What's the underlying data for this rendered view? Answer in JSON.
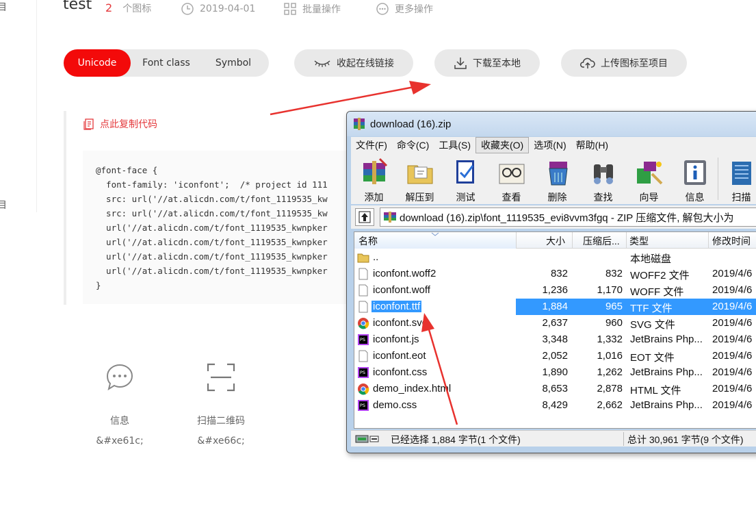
{
  "leftnav": {
    "item1": "目",
    "item2": "目"
  },
  "header": {
    "project_name": "test",
    "icon_count": "2",
    "icon_count_label": "个图标",
    "date": "2019-04-01",
    "batch_ops": "批量操作",
    "more_ops": "更多操作"
  },
  "tabs": {
    "unicode": "Unicode",
    "font_class": "Font class",
    "symbol": "Symbol"
  },
  "actions": {
    "collapse_link": "收起在线链接",
    "download": "下载至本地",
    "upload": "上传图标至项目"
  },
  "code": {
    "copy_label": "点此复制代码",
    "lines": [
      "@font-face {",
      "  font-family: 'iconfont';  /* project id 111",
      "  src: url('//at.alicdn.com/t/font_1119535_kw",
      "  src: url('//at.alicdn.com/t/font_1119535_kw",
      "  url('//at.alicdn.com/t/font_1119535_kwnpker",
      "  url('//at.alicdn.com/t/font_1119535_kwnpker",
      "  url('//at.alicdn.com/t/font_1119535_kwnpker",
      "  url('//at.alicdn.com/t/font_1119535_kwnpker",
      "}"
    ]
  },
  "icons": [
    {
      "name": "信息",
      "code": "&#xe61c;",
      "icon": "message-icon"
    },
    {
      "name": "扫描二维码",
      "code": "&#xe66c;",
      "icon": "scan-qr-icon"
    }
  ],
  "winrar": {
    "title": "download (16).zip",
    "menu": [
      "文件(F)",
      "命令(C)",
      "工具(S)",
      "收藏夹(O)",
      "选项(N)",
      "帮助(H)"
    ],
    "toolbar": [
      "添加",
      "解压到",
      "测试",
      "查看",
      "删除",
      "查找",
      "向导",
      "信息",
      "扫描"
    ],
    "path": "download (16).zip\\font_1119535_evi8vvm3fgq - ZIP 压缩文件, 解包大小为",
    "columns": {
      "name": "名称",
      "size": "大小",
      "packed": "压缩后...",
      "type": "类型",
      "modified": "修改时间"
    },
    "files": [
      {
        "name": "..",
        "size": "",
        "packed": "",
        "type": "本地磁盘",
        "modified": "",
        "icon": "folder-icon"
      },
      {
        "name": "iconfont.woff2",
        "size": "832",
        "packed": "832",
        "type": "WOFF2 文件",
        "modified": "2019/4/6",
        "icon": "file-icon"
      },
      {
        "name": "iconfont.woff",
        "size": "1,236",
        "packed": "1,170",
        "type": "WOFF 文件",
        "modified": "2019/4/6",
        "icon": "file-icon"
      },
      {
        "name": "iconfont.ttf",
        "size": "1,884",
        "packed": "965",
        "type": "TTF 文件",
        "modified": "2019/4/6",
        "icon": "file-icon"
      },
      {
        "name": "iconfont.svg",
        "size": "2,637",
        "packed": "960",
        "type": "SVG 文件",
        "modified": "2019/4/6",
        "icon": "chrome-icon"
      },
      {
        "name": "iconfont.js",
        "size": "3,348",
        "packed": "1,332",
        "type": "JetBrains Php...",
        "modified": "2019/4/6",
        "icon": "phpstorm-icon"
      },
      {
        "name": "iconfont.eot",
        "size": "2,052",
        "packed": "1,016",
        "type": "EOT 文件",
        "modified": "2019/4/6",
        "icon": "file-icon"
      },
      {
        "name": "iconfont.css",
        "size": "1,890",
        "packed": "1,262",
        "type": "JetBrains Php...",
        "modified": "2019/4/6",
        "icon": "phpstorm-icon"
      },
      {
        "name": "demo_index.html",
        "size": "8,653",
        "packed": "2,878",
        "type": "HTML 文件",
        "modified": "2019/4/6",
        "icon": "chrome-icon"
      },
      {
        "name": "demo.css",
        "size": "8,429",
        "packed": "2,662",
        "type": "JetBrains Php...",
        "modified": "2019/4/6",
        "icon": "phpstorm-icon"
      }
    ],
    "status_left": "已经选择 1,884 字节(1 个文件)",
    "status_right": "总计 30,961 字节(9 个文件)"
  },
  "colors": {
    "accent": "#f30a0a",
    "selection": "#3399ff",
    "annotation_arrow": "#e8322e"
  }
}
